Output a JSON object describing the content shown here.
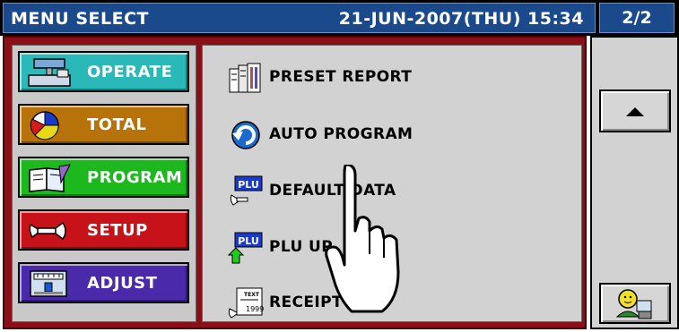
{
  "header": {
    "title": "MENU SELECT",
    "datetime": "21-JUN-2007(THU) 15:34",
    "page": "2/2"
  },
  "categories": [
    {
      "label": "OPERATE",
      "color": "#2bb8b8",
      "icon": "scale-icon"
    },
    {
      "label": "TOTAL",
      "color": "#b8720a",
      "icon": "pie-chart-icon"
    },
    {
      "label": "PROGRAM",
      "color": "#1db81d",
      "icon": "book-icon"
    },
    {
      "label": "SETUP",
      "color": "#c8121a",
      "icon": "wrench-icon"
    },
    {
      "label": "ADJUST",
      "color": "#4a2aa8",
      "icon": "calibration-icon"
    }
  ],
  "menu": [
    {
      "label": "PRESET REPORT",
      "icon": "report-icon"
    },
    {
      "label": "AUTO PROGRAM",
      "icon": "refresh-icon"
    },
    {
      "label": "DEFAULT DATA",
      "icon": "plu-default-icon"
    },
    {
      "label": "PLU UP",
      "icon": "plu-upload-icon"
    },
    {
      "label": "RECEIPT TING",
      "icon": "receipt-icon"
    }
  ],
  "side": {
    "up_icon": "arrow-up-icon",
    "user_icon": "user-icon"
  },
  "plu_badge": "PLU",
  "receipt_badge_top": "TEXT",
  "receipt_badge_bottom": "1999"
}
